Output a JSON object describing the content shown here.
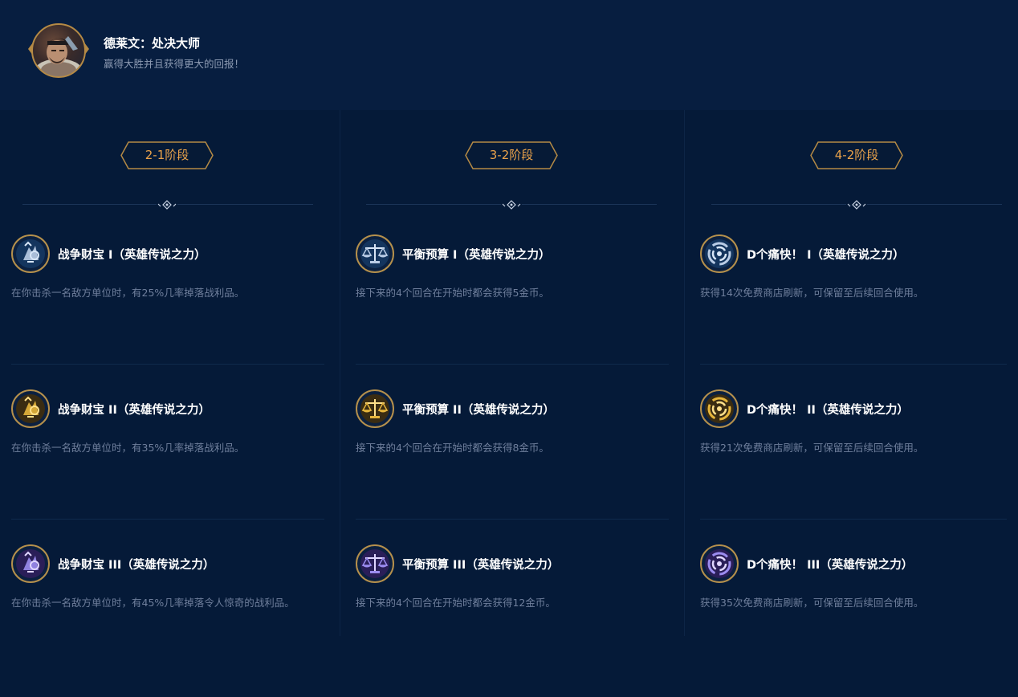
{
  "header": {
    "title": "德莱文：处决大师",
    "subtitle": "赢得大胜并且获得更大的回报！"
  },
  "colors": {
    "background": "#051a38",
    "header_background": "#071e40",
    "gold": "#b58a45",
    "stage_text": "#e9a24a",
    "title_text": "#ffffff",
    "desc_text": "#6f7f9c"
  },
  "columns": [
    {
      "stage": "2-1阶段",
      "augments": [
        {
          "icon": "war-treasure-icon",
          "tier": "silver",
          "title": "战争财宝 I（英雄传说之力）",
          "desc": "在你击杀一名敌方单位时，有25%几率掉落战利品。"
        },
        {
          "icon": "war-treasure-icon",
          "tier": "gold",
          "title": "战争财宝 II（英雄传说之力）",
          "desc": "在你击杀一名敌方单位时，有35%几率掉落战利品。"
        },
        {
          "icon": "war-treasure-icon",
          "tier": "prismatic",
          "title": "战争财宝 III（英雄传说之力）",
          "desc": "在你击杀一名敌方单位时，有45%几率掉落令人惊奇的战利品。"
        }
      ]
    },
    {
      "stage": "3-2阶段",
      "augments": [
        {
          "icon": "balance-scale-icon",
          "tier": "silver",
          "title": "平衡预算 I（英雄传说之力）",
          "desc": "接下来的4个回合在开始时都会获得5金币。"
        },
        {
          "icon": "balance-scale-icon",
          "tier": "gold",
          "title": "平衡预算 II（英雄传说之力）",
          "desc": "接下来的4个回合在开始时都会获得8金币。"
        },
        {
          "icon": "balance-scale-icon",
          "tier": "prismatic",
          "title": "平衡预算 III（英雄传说之力）",
          "desc": "接下来的4个回合在开始时都会获得12金币。"
        }
      ]
    },
    {
      "stage": "4-2阶段",
      "augments": [
        {
          "icon": "swirl-refresh-icon",
          "tier": "silver",
          "title": "D个痛快！ I（英雄传说之力）",
          "desc": "获得14次免费商店刷新，可保留至后续回合使用。"
        },
        {
          "icon": "swirl-refresh-icon",
          "tier": "gold",
          "title": "D个痛快！ II（英雄传说之力）",
          "desc": "获得21次免费商店刷新，可保留至后续回合使用。"
        },
        {
          "icon": "swirl-refresh-icon",
          "tier": "prismatic",
          "title": "D个痛快！ III（英雄传说之力）",
          "desc": "获得35次免费商店刷新，可保留至后续回合使用。"
        }
      ]
    }
  ]
}
